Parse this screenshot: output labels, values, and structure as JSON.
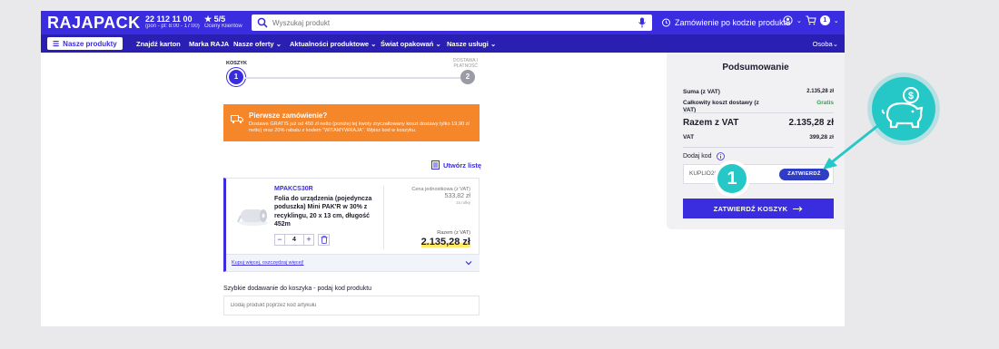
{
  "header": {
    "logo": "RAJAPACK",
    "phone": "22 112 11 00",
    "hours": "(pon - pt: 8:00 - 17:00)",
    "rating": "5/5",
    "rating_sub": "Oceny Klientów",
    "search_placeholder": "Wyszukaj produkt",
    "order_by_code": "Zamówienie po kodzie produktu",
    "cart_count": "1"
  },
  "nav": {
    "products": "Nasze produkty",
    "items": [
      "Znajdź karton",
      "Marka RAJA",
      "Nasze oferty",
      "Aktualności produktowe",
      "Świat opakowań",
      "Nasze usługi"
    ],
    "person": "Osoba"
  },
  "stepper": {
    "step1_label": "KOSZYK",
    "step1_num": "1",
    "step2_label_a": "DOSTAWA I",
    "step2_label_b": "PŁATNOŚĆ",
    "step2_num": "2"
  },
  "promo": {
    "title": "Pierwsze zamówienie?",
    "text": "Dostawa GRATIS już od 450 zł netto (poniżej tej kwoty zryczałtowany koszt dostawy tylko 19,90 zł netto) oraz 20% rabatu z kodem \"WITAMYWRAJA\". Wpisz kod w koszyku."
  },
  "create_list": "Utwórz listę",
  "product": {
    "sku": "MPAKCS30R",
    "name": "Folia do urządzenia (pojedyncza poduszka) Mini PAK'R w 30% z recyklingu, 20 x 13 cm, długość 452m",
    "qty": "4",
    "unit_label": "Cena jednostkowa (z VAT)",
    "unit_price": "533,82 zł",
    "unit_per": "za rolkę",
    "total_label": "Razem (z VAT)",
    "total_price": "2.135,28 zł",
    "buy_more": "Kupuj więcej, oszczędzaj więcej!"
  },
  "quick_add": {
    "label": "Szybkie dodawanie do koszyka - podaj kod produktu",
    "placeholder": "Dodaj produkt poprzez kod artykułu"
  },
  "summary": {
    "title": "Podsumowanie",
    "sum_label": "Suma (z VAT)",
    "sum_value": "2.135,28 zł",
    "delivery_label_a": "Całkowity koszt dostawy (z",
    "delivery_label_b": "VAT)",
    "delivery_value": "Gratis",
    "total_label": "Razem z VAT",
    "total_value": "2.135,28 zł",
    "vat_label": "VAT",
    "vat_value": "399,28 zł",
    "code_label": "Dodaj kod",
    "code_value": "KUPLIO20",
    "apply_label": "ZATWIERDŹ",
    "checkout_label": "ZATWIERDŹ KOSZYK"
  },
  "annotation": {
    "badge": "1"
  },
  "colors": {
    "brand": "#3a2de0",
    "promo": "#f5862a",
    "accent_teal": "#26c7c7",
    "gratis": "#2eaa4a"
  }
}
